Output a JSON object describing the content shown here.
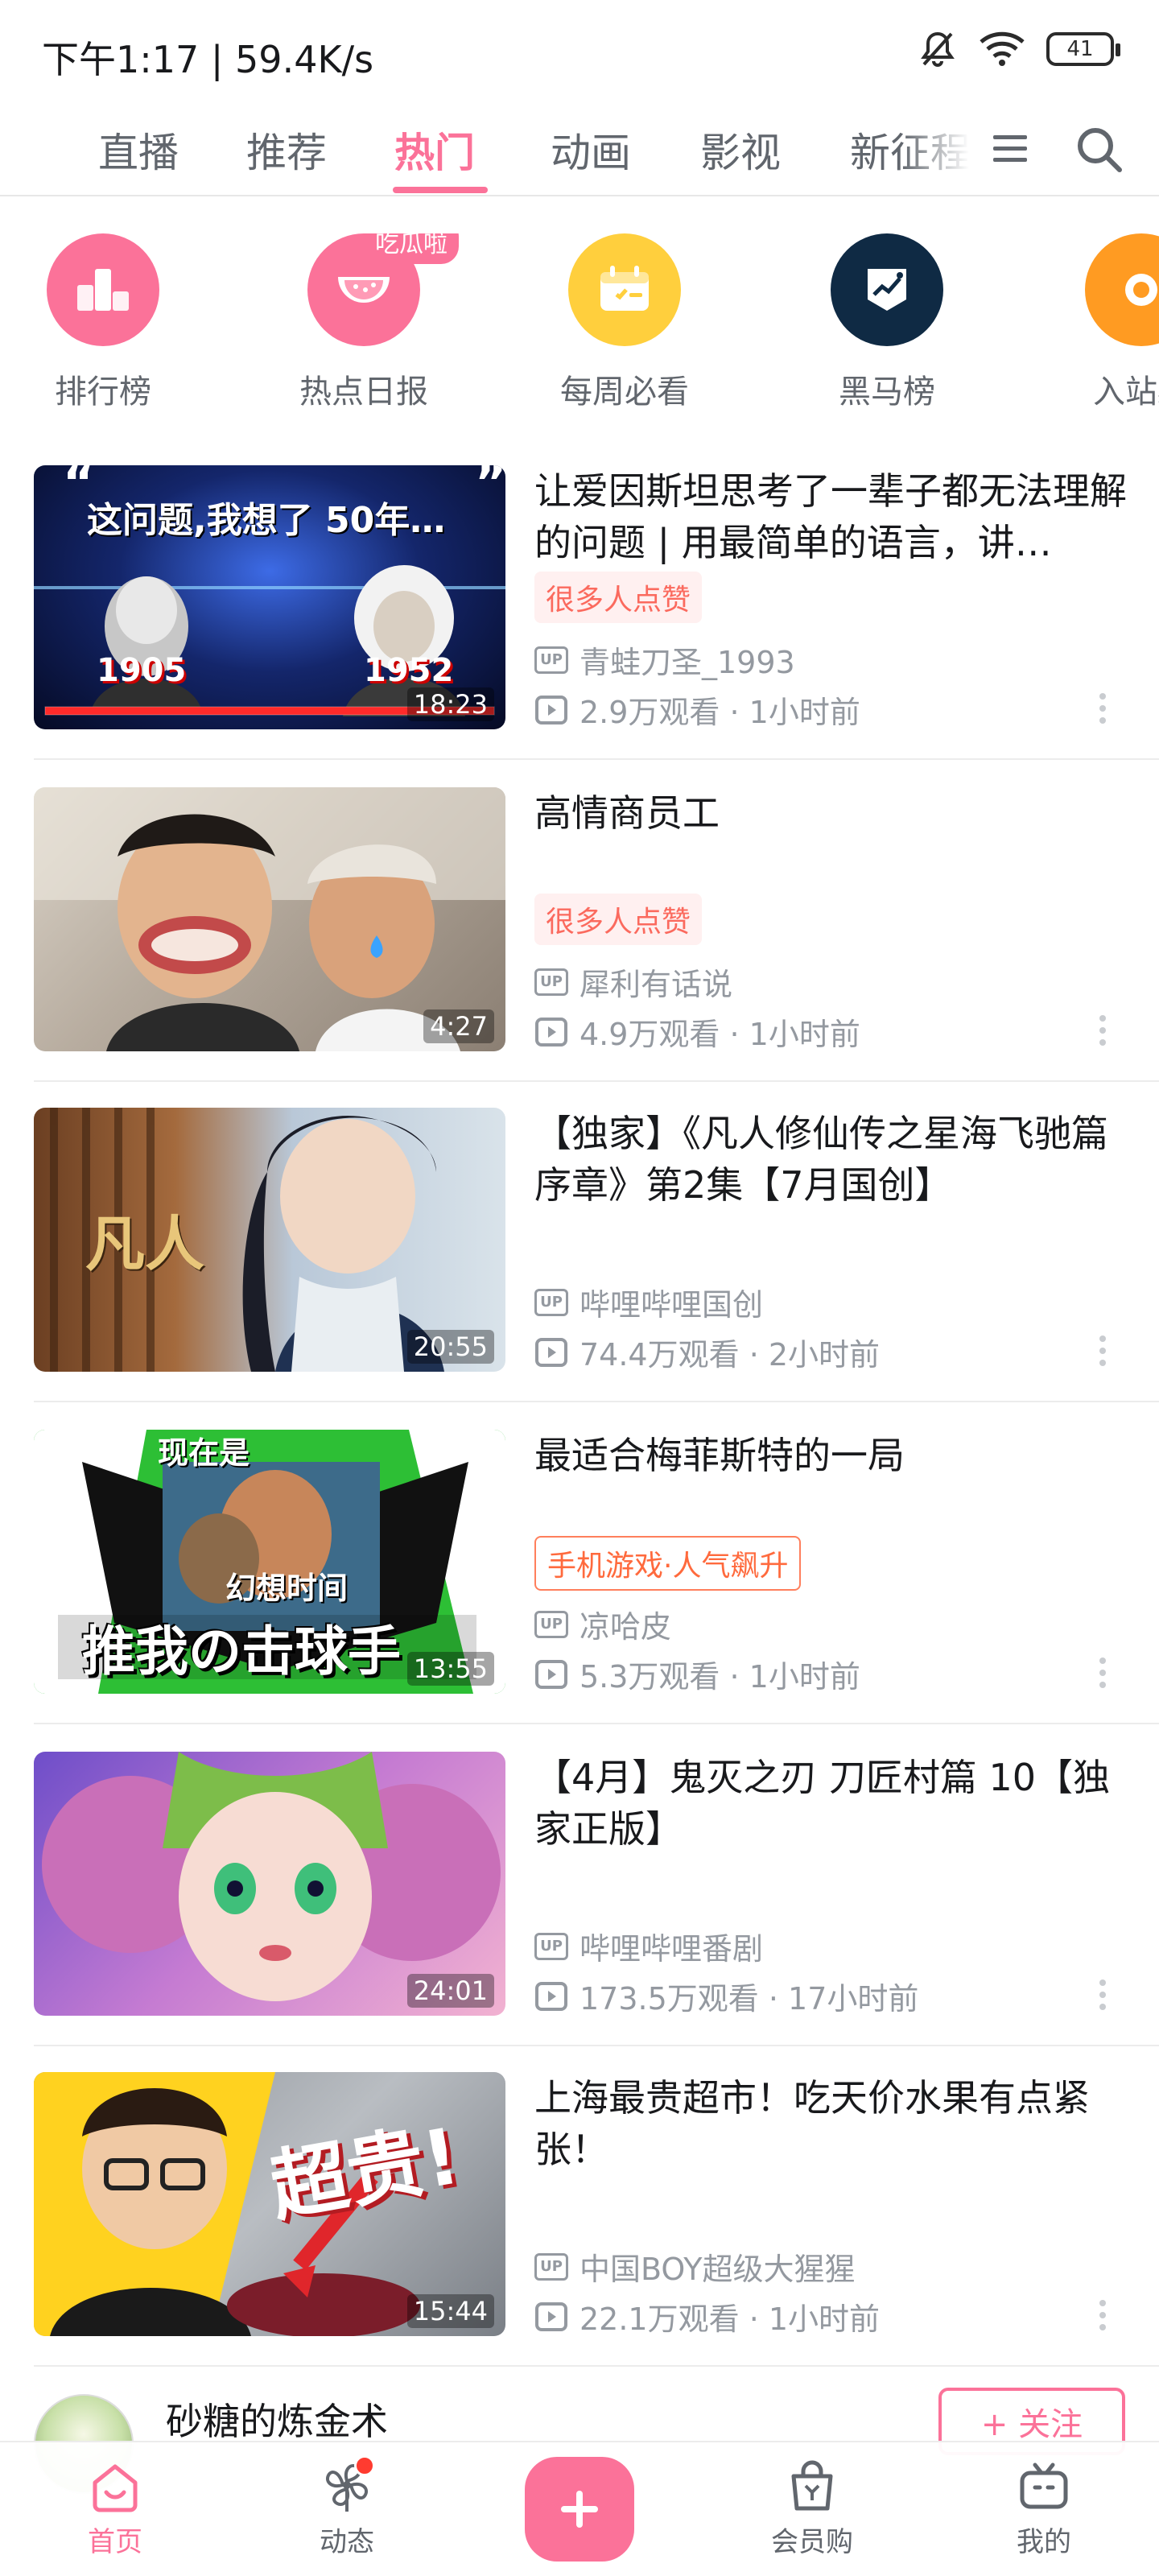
{
  "status_bar": {
    "time_speed": "下午1:17 | 59.4K/s",
    "battery": "41"
  },
  "tabs": [
    "直播",
    "推荐",
    "热门",
    "动画",
    "影视",
    "新征程"
  ],
  "active_tab": "热门",
  "categories": [
    {
      "label": "排行榜",
      "color": "#fb7299"
    },
    {
      "label": "热点日报",
      "color": "#fb7299",
      "badge": "吃瓜啦"
    },
    {
      "label": "每周必看",
      "color": "#ffcf3d"
    },
    {
      "label": "黑马榜",
      "color": "#0f2a44"
    },
    {
      "label": "入站必",
      "color": "#ff9b22"
    }
  ],
  "videos": [
    {
      "title": "让爱因斯坦思考了一辈子都无法理解的问题 | 用最简单的语言，讲…",
      "tag": "很多人点赞",
      "uploader": "青蛙刀圣_1993",
      "views_time": "2.9万观看 · 1小时前",
      "duration": "18:23",
      "thumb_text": "这问题,我想了 50年…",
      "thumb_years": [
        "1905",
        "1952"
      ]
    },
    {
      "title": "高情商员工",
      "tag": "很多人点赞",
      "uploader": "犀利有话说",
      "views_time": "4.9万观看 · 1小时前",
      "duration": "4:27"
    },
    {
      "title": "【独家】《凡人修仙传之星海飞驰篇序章》第2集【7月国创】",
      "tag": "",
      "uploader": "哔哩哔哩国创",
      "views_time": "74.4万观看 · 2小时前",
      "duration": "20:55",
      "thumb_text": "凡人"
    },
    {
      "title": "最适合梅菲斯特的一局",
      "tag": "手机游戏·人气飙升",
      "uploader": "凉哈皮",
      "views_time": "5.3万观看 · 1小时前",
      "duration": "13:55",
      "thumb_text_top": "现在是",
      "thumb_text_mid": "幻想时间",
      "thumb_text_big": "推我の击球手"
    },
    {
      "title": "【4月】鬼灭之刃 刀匠村篇 10【独家正版】",
      "tag": "",
      "uploader": "哔哩哔哩番剧",
      "views_time": "173.5万观看 · 17小时前",
      "duration": "24:01"
    },
    {
      "title": "上海最贵超市！吃天价水果有点紧张！",
      "tag": "",
      "uploader": "中国BOY超级大猩猩",
      "views_time": "22.1万观看 · 1小时前",
      "duration": "15:44",
      "thumb_text": "超贵!"
    }
  ],
  "live_row": {
    "name": "砂糖的炼金术",
    "follow_label": "+ 关注"
  },
  "bottom_nav": [
    {
      "label": "首页",
      "icon": "home-icon"
    },
    {
      "label": "动态",
      "icon": "pinwheel-icon"
    },
    {
      "label": "",
      "icon": "plus-icon"
    },
    {
      "label": "会员购",
      "icon": "shopping-bag-icon"
    },
    {
      "label": "我的",
      "icon": "tv-icon"
    }
  ],
  "colors": {
    "accent": "#fb7299",
    "text": "#18191c",
    "secondary": "#9499a0"
  }
}
